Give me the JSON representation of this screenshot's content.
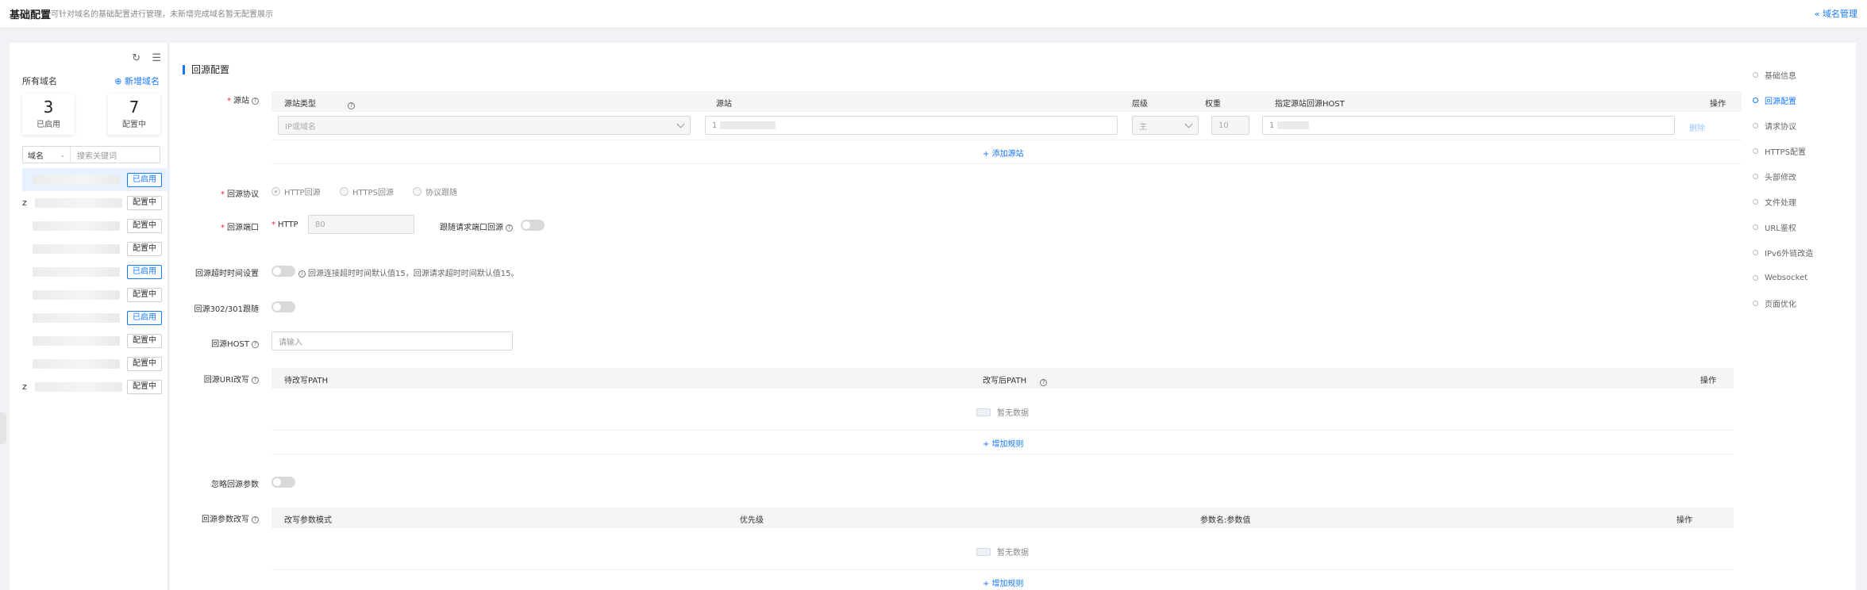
{
  "header": {
    "title": "基础配置",
    "desc": "可针对域名的基础配置进行管理，未新增完成域名暂无配置展示",
    "domain_mgmt": "« 域名管理"
  },
  "sidebar": {
    "all_domains": "所有域名",
    "add_domain": "⊕ 新增域名",
    "refresh_icon": "↻",
    "list_icon": "☰",
    "stats": [
      {
        "num": "3",
        "label": "已启用"
      },
      {
        "num": "7",
        "label": "配置中"
      }
    ],
    "filter_select": "域名",
    "filter_placeholder": "搜索关键词",
    "items": [
      {
        "prefix": "",
        "status": "已启用",
        "on": true
      },
      {
        "prefix": "z",
        "status": "配置中",
        "on": false
      },
      {
        "prefix": "",
        "status": "配置中",
        "on": false
      },
      {
        "prefix": "",
        "status": "配置中",
        "on": false
      },
      {
        "prefix": "",
        "status": "已启用",
        "on": true
      },
      {
        "prefix": "",
        "status": "配置中",
        "on": false
      },
      {
        "prefix": "",
        "status": "已启用",
        "on": true
      },
      {
        "prefix": "",
        "status": "配置中",
        "on": false
      },
      {
        "prefix": "",
        "status": "配置中",
        "on": false
      },
      {
        "prefix": "z",
        "status": "配置中",
        "on": false
      }
    ]
  },
  "main": {
    "section_title": "回源配置",
    "origin": {
      "label": "源站",
      "cols": [
        "源站类型",
        "源站",
        "层级",
        "权重",
        "指定源站回源HOST",
        "操作"
      ],
      "type_value": "IP或域名",
      "origin_value": "1",
      "level_value": "主",
      "weight_value": "10",
      "host_value": "1",
      "delete": "删除",
      "add": "+ 添加源站"
    },
    "protocol": {
      "label": "回源协议",
      "options": [
        "HTTP回源",
        "HTTPS回源",
        "协议跟随"
      ]
    },
    "port": {
      "label": "回源端口",
      "http_label": "HTTP",
      "http_value": "80",
      "follow_label": "跟随请求端口回源"
    },
    "timeout": {
      "label": "回源超时时间设置",
      "hint": "回源连接超时时间默认值15，回源请求超时时间默认值15。"
    },
    "redirect": {
      "label": "回源302/301跟随"
    },
    "host": {
      "label": "回源HOST",
      "placeholder": "请输入"
    },
    "uri": {
      "label": "回源URI改写",
      "cols": [
        "待改写PATH",
        "改写后PATH",
        "操作"
      ],
      "empty": "暂无数据",
      "add": "+ 增加规则"
    },
    "ignore_params": {
      "label": "忽略回源参数"
    },
    "param_rewrite": {
      "label": "回源参数改写",
      "cols": [
        "改写参数模式",
        "优先级",
        "参数名:参数值",
        "操作"
      ],
      "empty": "暂无数据",
      "add": "+ 增加规则"
    }
  },
  "anchor": [
    "基础信息",
    "回源配置",
    "请求协议",
    "HTTPS配置",
    "头部修改",
    "文件处理",
    "URL鉴权",
    "IPv6外链改造",
    "Websocket",
    "页面优化"
  ]
}
